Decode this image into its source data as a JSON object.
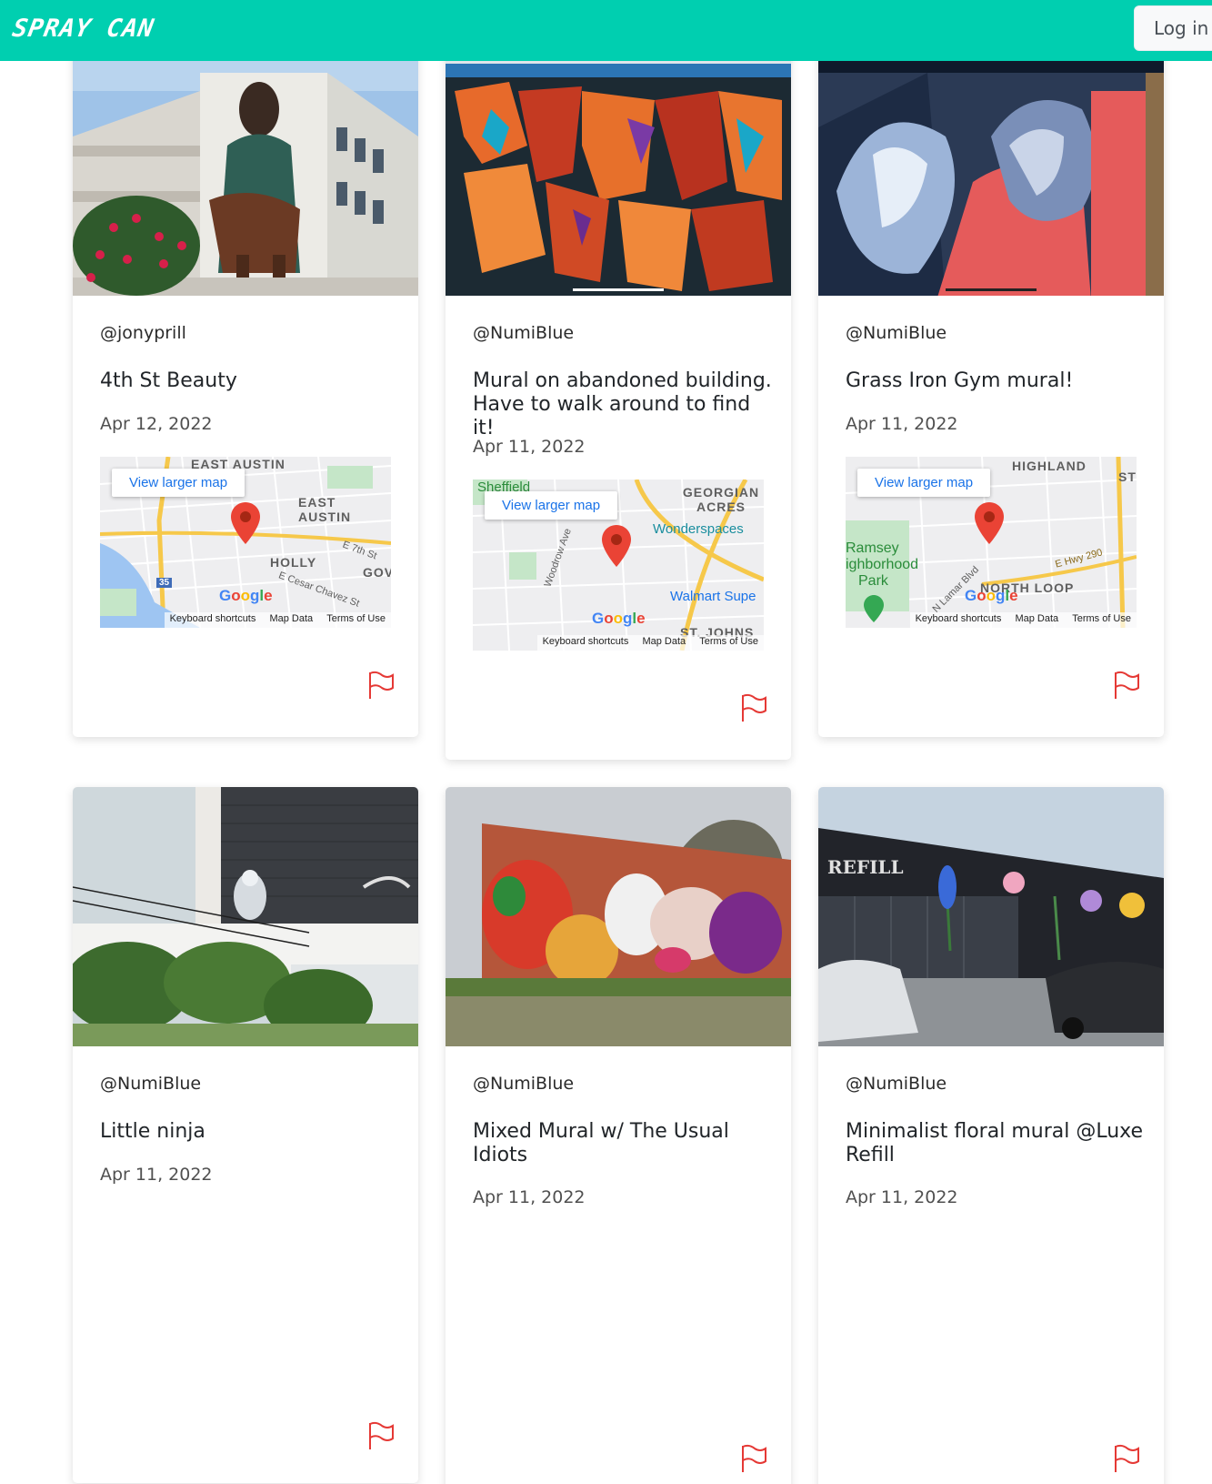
{
  "header": {
    "brand": "SPRAY CAN",
    "login_label": "Log in",
    "brand_color": "#00cfb0"
  },
  "map_common": {
    "view_larger": "View larger map",
    "footer": [
      "Keyboard shortcuts",
      "Map Data",
      "Terms of Use"
    ],
    "google": "Google"
  },
  "posts": [
    {
      "username": "@jonyprill",
      "title": "4th St Beauty",
      "date": "Apr 12, 2022",
      "map_labels": [
        "EAST AUSTIN",
        "EAST AUSTIN",
        "HOLLY",
        "GOV",
        "E 7th St",
        "E Cesar Chavez St",
        "35"
      ],
      "flag_icon": "flag-icon"
    },
    {
      "username": "@NumiBlue",
      "title": "Mural on abandoned building. Have to walk around to find it!",
      "date": "Apr 11, 2022",
      "map_labels": [
        "Sheffield",
        "GEORGIAN ACRES",
        "Wonderspaces",
        "Walmart Supe",
        "Woodrow Ave",
        "ST. JOHNS"
      ],
      "flag_icon": "flag-icon"
    },
    {
      "username": "@NumiBlue",
      "title": "Grass Iron Gym mural!",
      "date": "Apr 11, 2022",
      "map_labels": [
        "HIGHLAND",
        "ST",
        "Ramsey",
        "ighborhood",
        "Park",
        "E Hwy 290",
        "NORTH LOOP",
        "N Lamar Blvd"
      ],
      "flag_icon": "flag-icon"
    },
    {
      "username": "@NumiBlue",
      "title": "Little ninja",
      "date": "Apr 11, 2022",
      "flag_icon": "flag-icon"
    },
    {
      "username": "@NumiBlue",
      "title": "Mixed Mural w/ The Usual Idiots",
      "date": "Apr 11, 2022",
      "flag_icon": "flag-icon"
    },
    {
      "username": "@NumiBlue",
      "title": "Minimalist floral mural @Luxe Refill",
      "date": "Apr 11, 2022",
      "flag_icon": "flag-icon",
      "photo_sign": "REFILL"
    }
  ],
  "colors": {
    "flag": "#e53935",
    "map_pin": "#ea4335"
  }
}
